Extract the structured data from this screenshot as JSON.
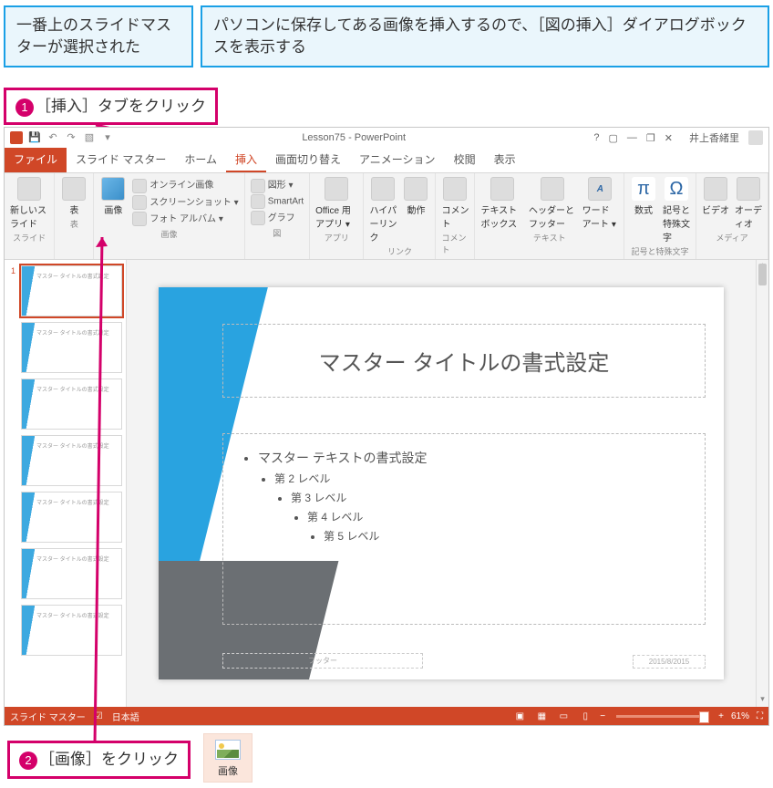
{
  "notes": {
    "top_left": "一番上のスライドマスターが選択された",
    "top_right": "パソコンに保存してある画像を挿入するので、［図の挿入］ダイアログボックスを表示する",
    "callout1_num": "1",
    "callout1_text": "［挿入］タブをクリック",
    "callout2_num": "2",
    "callout2_text": "［画像］をクリック"
  },
  "titlebar": {
    "doc": "Lesson75 - PowerPoint",
    "user": "井上香緒里",
    "help": "?",
    "ribbon_opts": "▢",
    "min": "—",
    "restore": "❐",
    "close": "✕"
  },
  "tabs": {
    "file": "ファイル",
    "slide_master": "スライド マスター",
    "home": "ホーム",
    "insert": "挿入",
    "transitions": "画面切り替え",
    "animations": "アニメーション",
    "review": "校閲",
    "view": "表示"
  },
  "ribbon": {
    "new_slide": "新しいスライド",
    "table": "表",
    "images": "画像",
    "online_images": "オンライン画像",
    "screenshot": "スクリーンショット ▾",
    "photo_album": "フォト アルバム ▾",
    "shapes": "図形 ▾",
    "smartart": "SmartArt",
    "chart": "グラフ",
    "office_apps": "Office 用アプリ ▾",
    "hyperlink": "ハイパーリンク",
    "action": "動作",
    "comment": "コメント",
    "textbox": "テキストボックス",
    "header_footer": "ヘッダーとフッター",
    "wordart": "ワードアート ▾",
    "equation": "数式",
    "symbol": "記号と特殊文字",
    "video": "ビデオ",
    "audio": "オーディオ",
    "grp_slide": "スライド",
    "grp_table": "表",
    "grp_images": "画像",
    "grp_illust": "図",
    "grp_apps": "アプリ",
    "grp_links": "リンク",
    "grp_comment": "コメント",
    "grp_text": "テキスト",
    "grp_symbols": "記号と特殊文字",
    "grp_media": "メディア"
  },
  "thumbs": {
    "n1": "1",
    "master_title": "マスター タイトルの書式設定",
    "layout_title": "マスター タイトルの書式設定"
  },
  "slide": {
    "title": "マスター タイトルの書式設定",
    "l1": "マスター テキストの書式設定",
    "l2": "第 2 レベル",
    "l3": "第 3 レベル",
    "l4": "第 4 レベル",
    "l5": "第 5 レベル",
    "footer": "フッター",
    "date": "2015/8/2015"
  },
  "status": {
    "mode": "スライド マスター",
    "lang_icon": "�ации",
    "lang": "日本語",
    "zoom_minus": "−",
    "zoom_plus": "+",
    "zoom_val": "61%",
    "fit": "⛶"
  },
  "img_card": {
    "label": "画像"
  }
}
